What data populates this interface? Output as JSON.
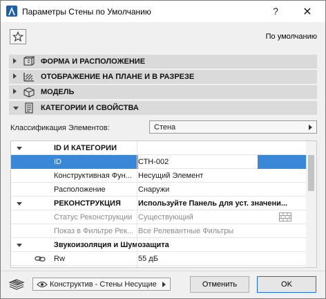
{
  "window": {
    "title": "Параметры Стены по Умолчанию",
    "help_label": "?",
    "close_label": "✕"
  },
  "favorites": {
    "star_icon": "star-icon",
    "preset_label": "По умолчанию"
  },
  "panels": [
    {
      "label": "ФОРМА И РАСПОЛОЖЕНИЕ",
      "icon": "wall-geometry-icon",
      "expanded": false
    },
    {
      "label": "ОТОБРАЖЕНИЕ НА ПЛАНЕ И В РАЗРЕЗЕ",
      "icon": "hatch-icon",
      "expanded": false
    },
    {
      "label": "МОДЕЛЬ",
      "icon": "box-model-icon",
      "expanded": false
    },
    {
      "label": "КАТЕГОРИИ И СВОЙСТВА",
      "icon": "document-icon",
      "expanded": true
    }
  ],
  "classification": {
    "label": "Классификация Элементов:",
    "value": "Стена"
  },
  "properties": {
    "rows": [
      {
        "kind": "group",
        "name": "ID И КАТЕГОРИИ",
        "value": ""
      },
      {
        "kind": "selected",
        "name": "ID",
        "value": "СТН-002"
      },
      {
        "kind": "item",
        "name": "Конструктивная Фун...",
        "value": "Несущий Элемент"
      },
      {
        "kind": "item",
        "name": "Расположение",
        "value": "Снаружи"
      },
      {
        "kind": "group",
        "name": "РЕКОНСТРУКЦИЯ",
        "value": "Используйте Панель для уст. значени..."
      },
      {
        "kind": "disabled",
        "name": "Статус Реконструкции",
        "value": "Существующий"
      },
      {
        "kind": "disabled",
        "name": "Показ в Фильтре Рек...",
        "value": "Все Релевантные Фильтры"
      },
      {
        "kind": "group",
        "name": "Звукоизоляция и Шумозащита",
        "value": ""
      },
      {
        "kind": "item",
        "name": "Rw",
        "value": "55 дБ"
      }
    ]
  },
  "footer": {
    "layers_icon": "layers-icon",
    "layer_value": "Конструктив - Стены Несущие",
    "cancel_label": "Отменить",
    "ok_label": "OK"
  },
  "colors": {
    "selection": "#3a87d8",
    "panel_header": "#dadada",
    "ok_border": "#1f6fcf"
  }
}
